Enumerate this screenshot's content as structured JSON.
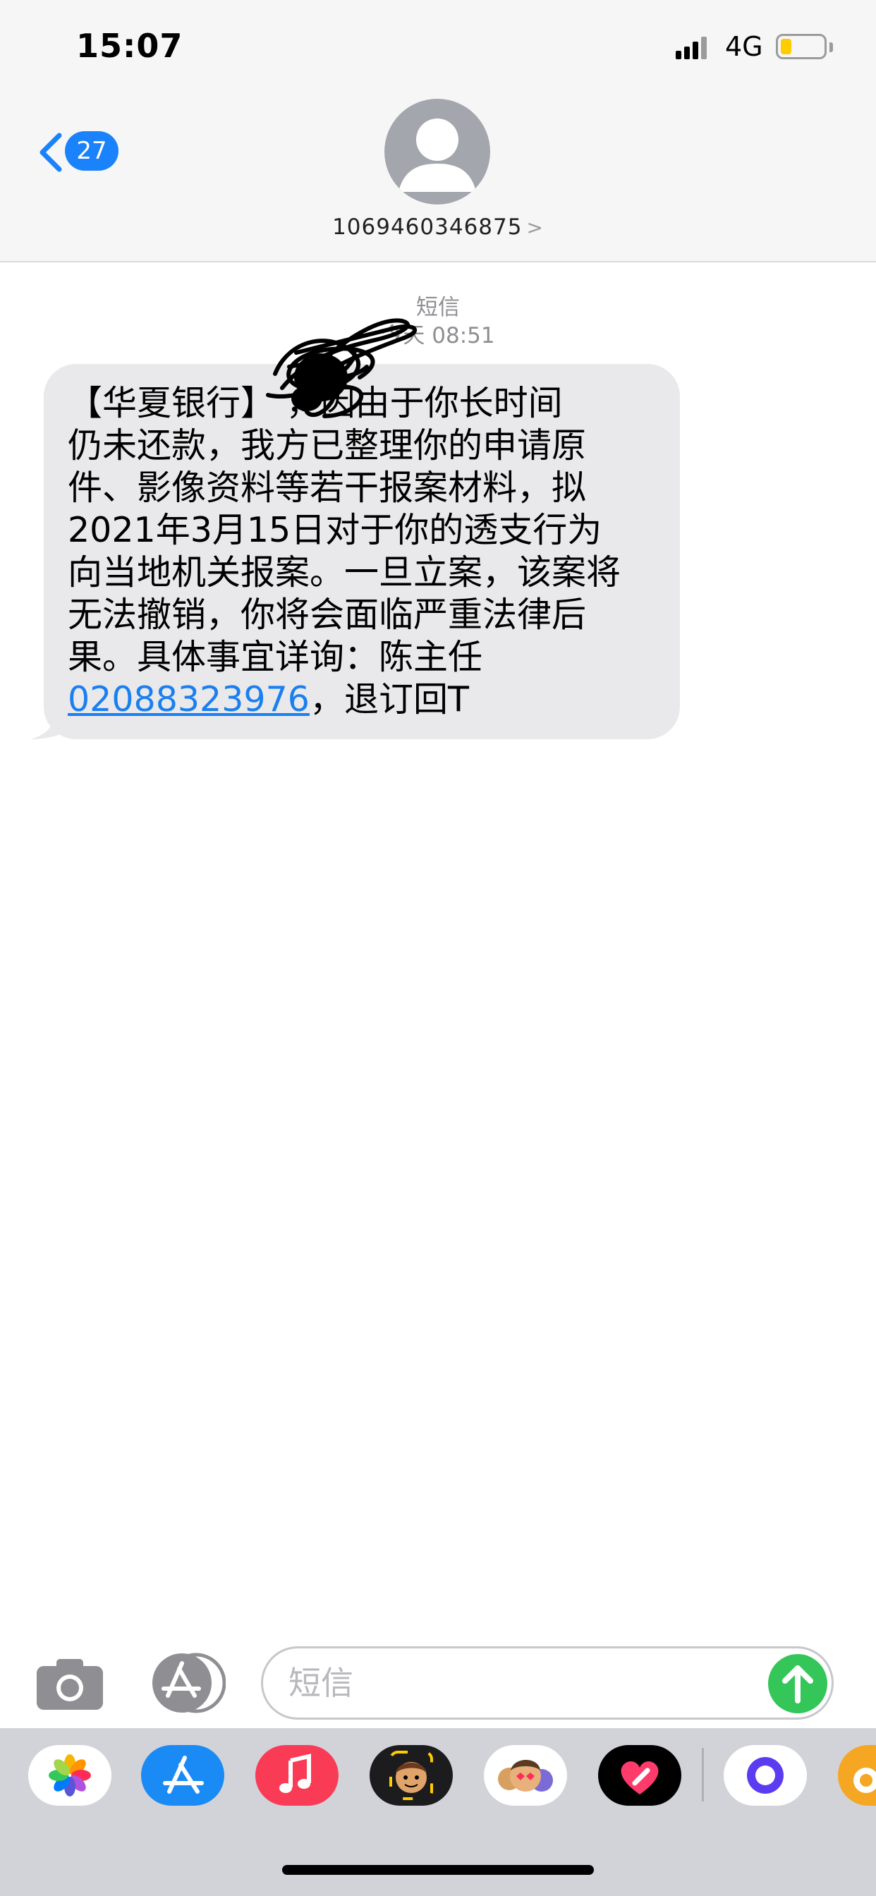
{
  "status_bar": {
    "time": "15:07",
    "network": "4G",
    "battery_level": 0.25
  },
  "header": {
    "back_count": "27",
    "sender": "1069460346875",
    "chevron": ">"
  },
  "conversation": {
    "message_type": "短信",
    "timestamp": "今天 08:51",
    "message": {
      "line1": "【华夏银行】",
      "line1_rest": "    ，因由于你长时间",
      "line2": "仍未还款，我方已整理你的申请原",
      "line3": "件、影像资料等若干报案材料，拟",
      "line4": "2021年3月15日对于你的透支行为",
      "line5": "向当地机关报案。一旦立案，该案将",
      "line6": "无法撤销，你将会面临严重法律后",
      "line7": "果。具体事宜详询：陈主任",
      "phone_link": "02088323976",
      "tail": "，退订回T"
    }
  },
  "input_bar": {
    "placeholder": "短信"
  },
  "app_drawer": {
    "apps": [
      {
        "name": "photos-app-icon"
      },
      {
        "name": "app-store-icon"
      },
      {
        "name": "music-app-icon"
      },
      {
        "name": "memoji-icon"
      },
      {
        "name": "memoji-stickers-icon"
      },
      {
        "name": "digital-touch-icon"
      },
      {
        "name": "chat-app-icon"
      },
      {
        "name": "weibo-app-icon"
      }
    ],
    "colors": {
      "music": "#fa3b55",
      "app_store": "#1a8af5",
      "chat": "#5b3cf0",
      "weibo": "#f5a623"
    }
  },
  "colors": {
    "accent": "#1a82fb",
    "send": "#34c659",
    "bubble": "#e9e9eb"
  }
}
